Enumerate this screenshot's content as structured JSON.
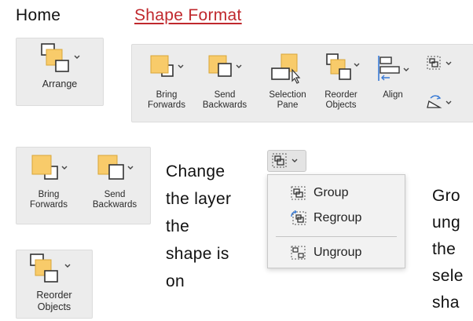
{
  "tabs": {
    "home": "Home",
    "shape_format": "Shape Format"
  },
  "arrange_button": {
    "label": "Arrange"
  },
  "ribbon": {
    "bring_forwards": [
      "Bring",
      "Forwards"
    ],
    "send_backwards": [
      "Send",
      "Backwards"
    ],
    "selection_pane": [
      "Selection",
      "Pane"
    ],
    "reorder_objects": [
      "Reorder",
      "Objects"
    ],
    "align": "Align"
  },
  "small_panel": {
    "bring_forwards": [
      "Bring",
      "Forwards"
    ],
    "send_backwards": [
      "Send",
      "Backwards"
    ]
  },
  "reorder_panel": [
    "Reorder",
    "Objects"
  ],
  "caption_left": [
    "Change",
    "the layer",
    "the",
    "shape is",
    "on"
  ],
  "group_menu": {
    "items": [
      "Group",
      "Regroup",
      "Ungroup"
    ]
  },
  "caption_right": [
    "Gro",
    "ung",
    "the",
    "sele",
    "sha"
  ],
  "colors": {
    "accent_link": "#c0282d",
    "shape_fill": "#f8cb6a",
    "panel_bg": "#ececec"
  }
}
